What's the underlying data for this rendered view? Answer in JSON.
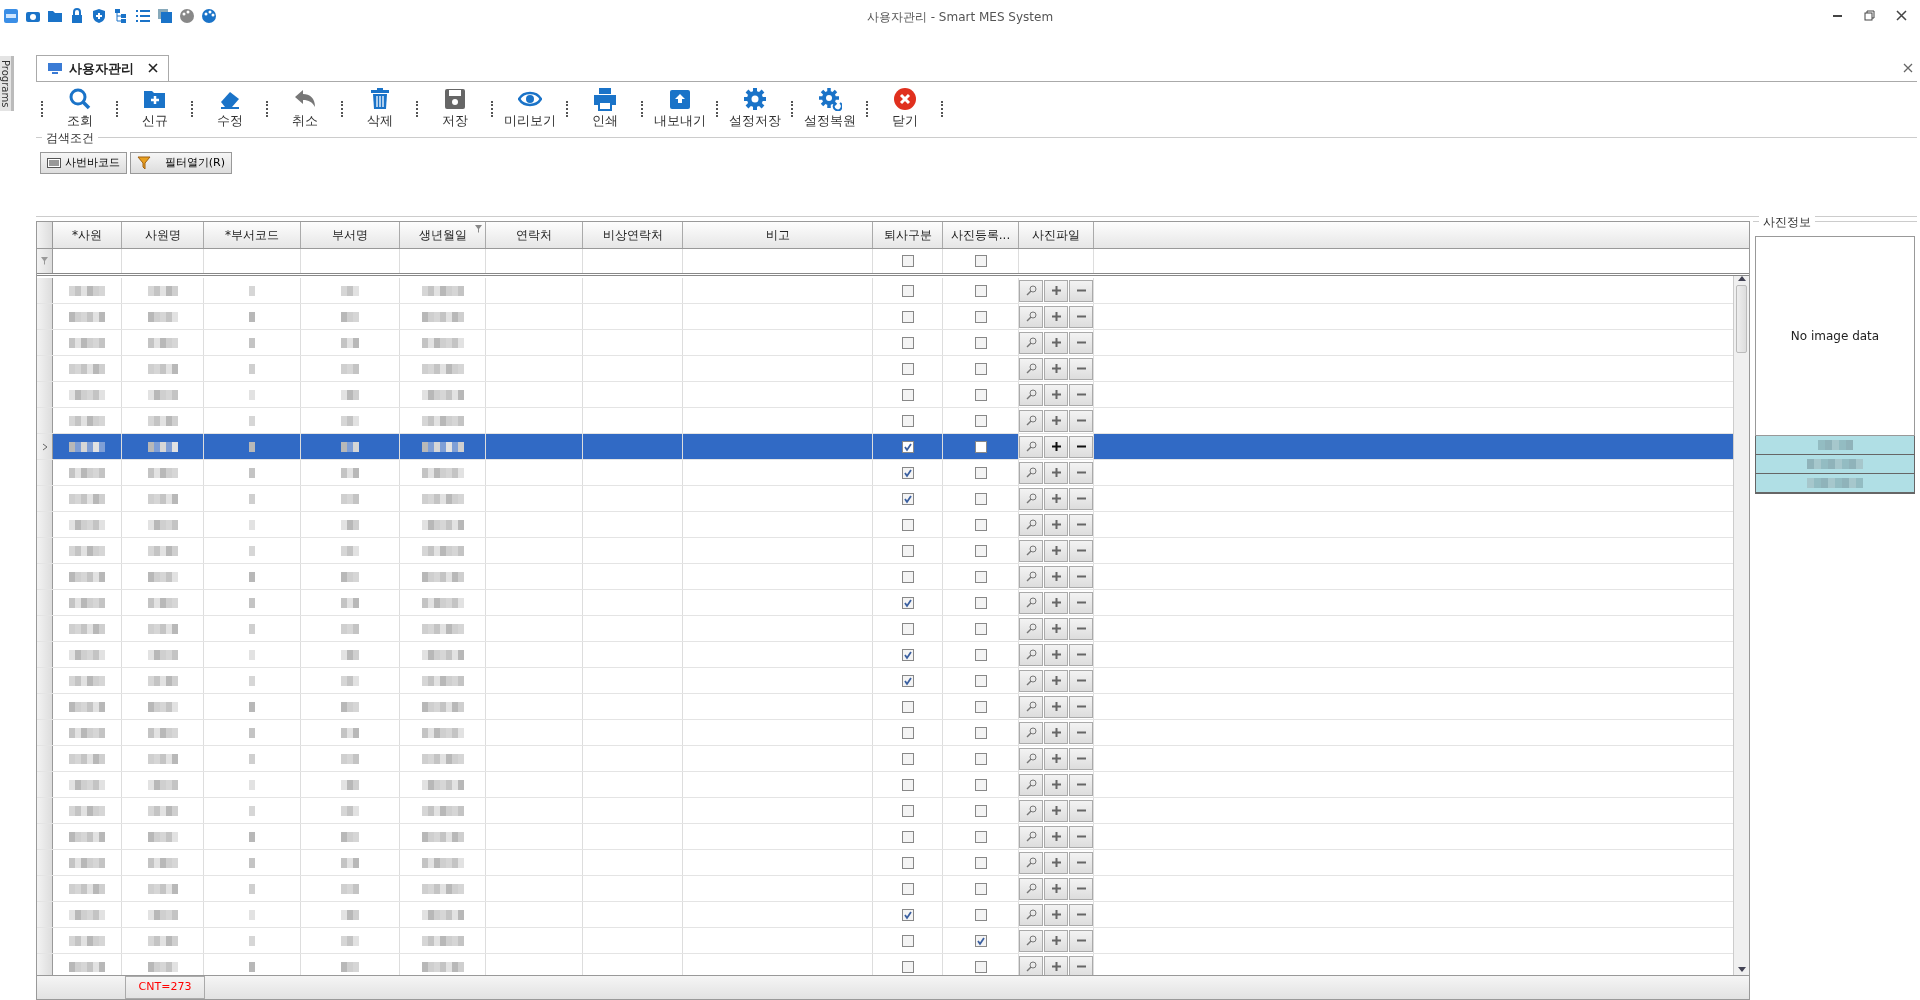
{
  "window": {
    "title": "사용자관리 - Smart MES System"
  },
  "side_tab": {
    "label": "Programs"
  },
  "doc_tabs": [
    {
      "label": "사용자관리",
      "selected": true
    }
  ],
  "toolbar": [
    {
      "label": "조회"
    },
    {
      "label": "신규"
    },
    {
      "label": "수정"
    },
    {
      "label": "취소"
    },
    {
      "label": "삭제"
    },
    {
      "label": "저장"
    },
    {
      "label": "미리보기"
    },
    {
      "label": "인쇄"
    },
    {
      "label": "내보내기"
    },
    {
      "label": "설정저장"
    },
    {
      "label": "설정복원"
    },
    {
      "label": "닫기"
    }
  ],
  "search_group": {
    "title": "검색조건",
    "buttons": [
      {
        "label": "사번바코드"
      },
      {
        "label": "필터열기(R)"
      }
    ]
  },
  "grid": {
    "columns": [
      {
        "label": "*사원",
        "filtered": false
      },
      {
        "label": "사원명",
        "filtered": false
      },
      {
        "label": "*부서코드",
        "filtered": false
      },
      {
        "label": "부서명",
        "filtered": false
      },
      {
        "label": "생년월일",
        "filtered": true
      },
      {
        "label": "연락처",
        "filtered": false
      },
      {
        "label": "비상연락처",
        "filtered": false
      },
      {
        "label": "비고",
        "filtered": false
      },
      {
        "label": "퇴사구분",
        "filtered": false
      },
      {
        "label": "사진등록...",
        "filtered": false
      },
      {
        "label": "사진파일",
        "filtered": false
      }
    ],
    "filter_row": {
      "retired": false,
      "photo_registered": false
    },
    "rows": [
      {
        "selected": false,
        "retired": false,
        "photo_registered": false
      },
      {
        "selected": false,
        "retired": false,
        "photo_registered": false
      },
      {
        "selected": false,
        "retired": false,
        "photo_registered": false
      },
      {
        "selected": false,
        "retired": false,
        "photo_registered": false
      },
      {
        "selected": false,
        "retired": false,
        "photo_registered": false
      },
      {
        "selected": false,
        "retired": false,
        "photo_registered": false
      },
      {
        "selected": true,
        "retired": true,
        "photo_registered": false
      },
      {
        "selected": false,
        "retired": true,
        "photo_registered": false
      },
      {
        "selected": false,
        "retired": true,
        "photo_registered": false
      },
      {
        "selected": false,
        "retired": false,
        "photo_registered": false
      },
      {
        "selected": false,
        "retired": false,
        "photo_registered": false
      },
      {
        "selected": false,
        "retired": false,
        "photo_registered": false
      },
      {
        "selected": false,
        "retired": true,
        "photo_registered": false
      },
      {
        "selected": false,
        "retired": false,
        "photo_registered": false
      },
      {
        "selected": false,
        "retired": true,
        "photo_registered": false
      },
      {
        "selected": false,
        "retired": true,
        "photo_registered": false
      },
      {
        "selected": false,
        "retired": false,
        "photo_registered": false
      },
      {
        "selected": false,
        "retired": false,
        "photo_registered": false
      },
      {
        "selected": false,
        "retired": false,
        "photo_registered": false
      },
      {
        "selected": false,
        "retired": false,
        "photo_registered": false
      },
      {
        "selected": false,
        "retired": false,
        "photo_registered": false
      },
      {
        "selected": false,
        "retired": false,
        "photo_registered": false
      },
      {
        "selected": false,
        "retired": false,
        "photo_registered": false
      },
      {
        "selected": false,
        "retired": false,
        "photo_registered": false
      },
      {
        "selected": false,
        "retired": true,
        "photo_registered": false
      },
      {
        "selected": false,
        "retired": false,
        "photo_registered": true
      },
      {
        "selected": false,
        "retired": false,
        "photo_registered": false
      }
    ]
  },
  "photo_panel": {
    "title": "사진정보",
    "message": "No image data"
  },
  "status_bar": {
    "count": "CNT=273"
  }
}
